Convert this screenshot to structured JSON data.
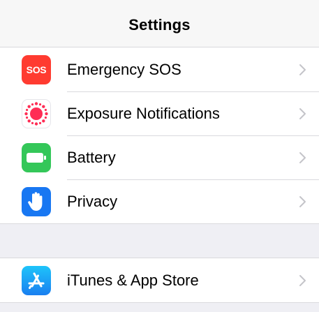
{
  "nav": {
    "title": "Settings"
  },
  "group1": {
    "items": [
      {
        "label": "Emergency SOS",
        "icon": "sos-icon",
        "icon_text": "SOS",
        "color": "#ff3b30"
      },
      {
        "label": "Exposure Notifications",
        "icon": "exposure-notifications-icon",
        "color": "#ffffff"
      },
      {
        "label": "Battery",
        "icon": "battery-icon",
        "color": "#34c759"
      },
      {
        "label": "Privacy",
        "icon": "privacy-hand-icon",
        "color": "#1877f2"
      }
    ]
  },
  "group2": {
    "items": [
      {
        "label": "iTunes & App Store",
        "icon": "app-store-icon",
        "color": "#1e8cf5"
      }
    ]
  },
  "colors": {
    "chevron": "#c4c4c9",
    "separator": "#d9d9dd",
    "background": "#efeff4"
  }
}
